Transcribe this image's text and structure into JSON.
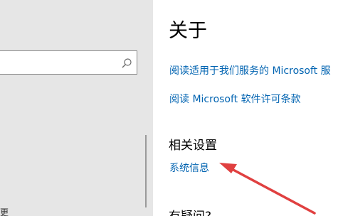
{
  "search": {
    "value": "",
    "placeholder": ""
  },
  "left_pane": {
    "bottom_text": "更"
  },
  "about": {
    "title": "关于",
    "link_service_agreement": "阅读适用于我们服务的 Microsoft 服",
    "link_license_terms": "阅读 Microsoft 软件许可条款"
  },
  "related_settings": {
    "title": "相关设置",
    "link_system_info": "系统信息"
  },
  "questions": {
    "title": "有疑问?"
  },
  "colors": {
    "link": "#0063b1",
    "left_pane_bg": "#e6e6e6",
    "annotation_arrow": "#e04040"
  }
}
